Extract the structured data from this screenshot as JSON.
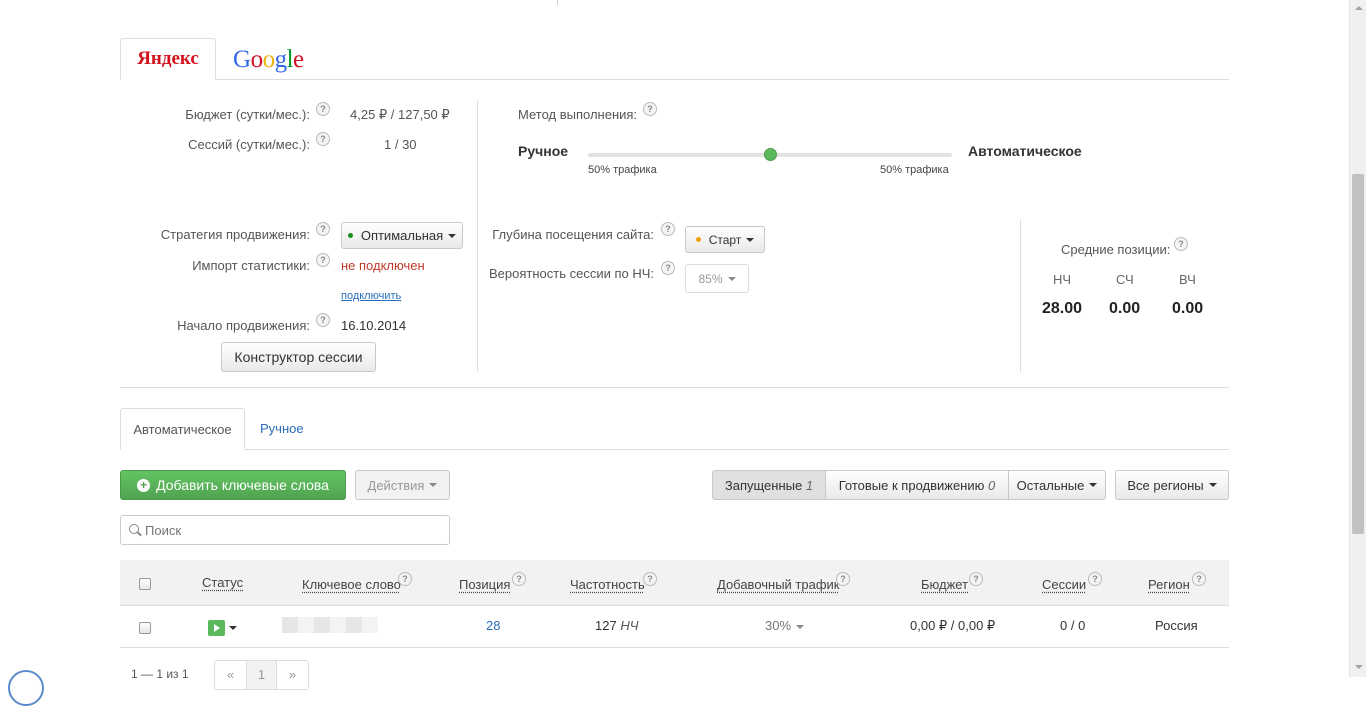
{
  "engine_tabs": {
    "yandex": "Яндекс",
    "google_letters": [
      "G",
      "o",
      "o",
      "g",
      "l",
      "e"
    ]
  },
  "left_stats": {
    "budget_label": "Бюджет (сутки/мес.):",
    "budget_value": "4,25 ₽ / 127,50 ₽",
    "sessions_label": "Сессий (сутки/мес.):",
    "sessions_value": "1 / 30"
  },
  "method": {
    "label": "Метод выполнения:",
    "manual": "Ручное",
    "auto": "Автоматическое",
    "traffic_left": "50% трафика",
    "traffic_right": "50% трафика",
    "slider_fraction": 0.5
  },
  "strategy": {
    "label": "Стратегия продвижения:",
    "value": "Оптимальная",
    "import_label": "Импорт статистики:",
    "import_value": "не подключен",
    "connect_link": "подключить",
    "start_label": "Начало продвижения:",
    "start_value": "16.10.2014",
    "constructor_button": "Конструктор сессии"
  },
  "depth": {
    "label": "Глубина посещения сайта:",
    "value": "Старт",
    "probability_label": "Вероятность сессии по НЧ:",
    "probability_value": "85%"
  },
  "avg_positions": {
    "label": "Средние позиции:",
    "cols": [
      {
        "name": "НЧ",
        "value": "28.00"
      },
      {
        "name": "СЧ",
        "value": "0.00"
      },
      {
        "name": "ВЧ",
        "value": "0.00"
      }
    ]
  },
  "mode_tabs": {
    "auto": "Автоматическое",
    "manual": "Ручное"
  },
  "toolbar": {
    "add_keywords": "Добавить ключевые слова",
    "actions": "Действия",
    "running": "Запущенные",
    "running_count": "1",
    "ready": "Готовые к продвижению",
    "ready_count": "0",
    "others": "Остальные",
    "regions": "Все регионы"
  },
  "search": {
    "placeholder": "Поиск"
  },
  "table": {
    "headers": {
      "status": "Статус",
      "keyword": "Ключевое слово",
      "position": "Позиция",
      "frequency": "Частотность",
      "traffic": "Добавочный трафик",
      "budget": "Бюджет",
      "sessions": "Сессии",
      "region": "Регион"
    },
    "row": {
      "position": "28",
      "frequency": "127",
      "frequency_unit": "НЧ",
      "traffic": "30%",
      "budget": "0,00 ₽ / 0,00 ₽",
      "sessions": "0 / 0",
      "region": "Россия"
    }
  },
  "pagination": {
    "summary": "1 — 1 из 1",
    "prev": "«",
    "page": "1",
    "next": "»"
  },
  "colors": {
    "green": "#5cb85c",
    "link": "#2a6ebb",
    "red": "#c0392b",
    "yandex_red": "#d4121e"
  }
}
